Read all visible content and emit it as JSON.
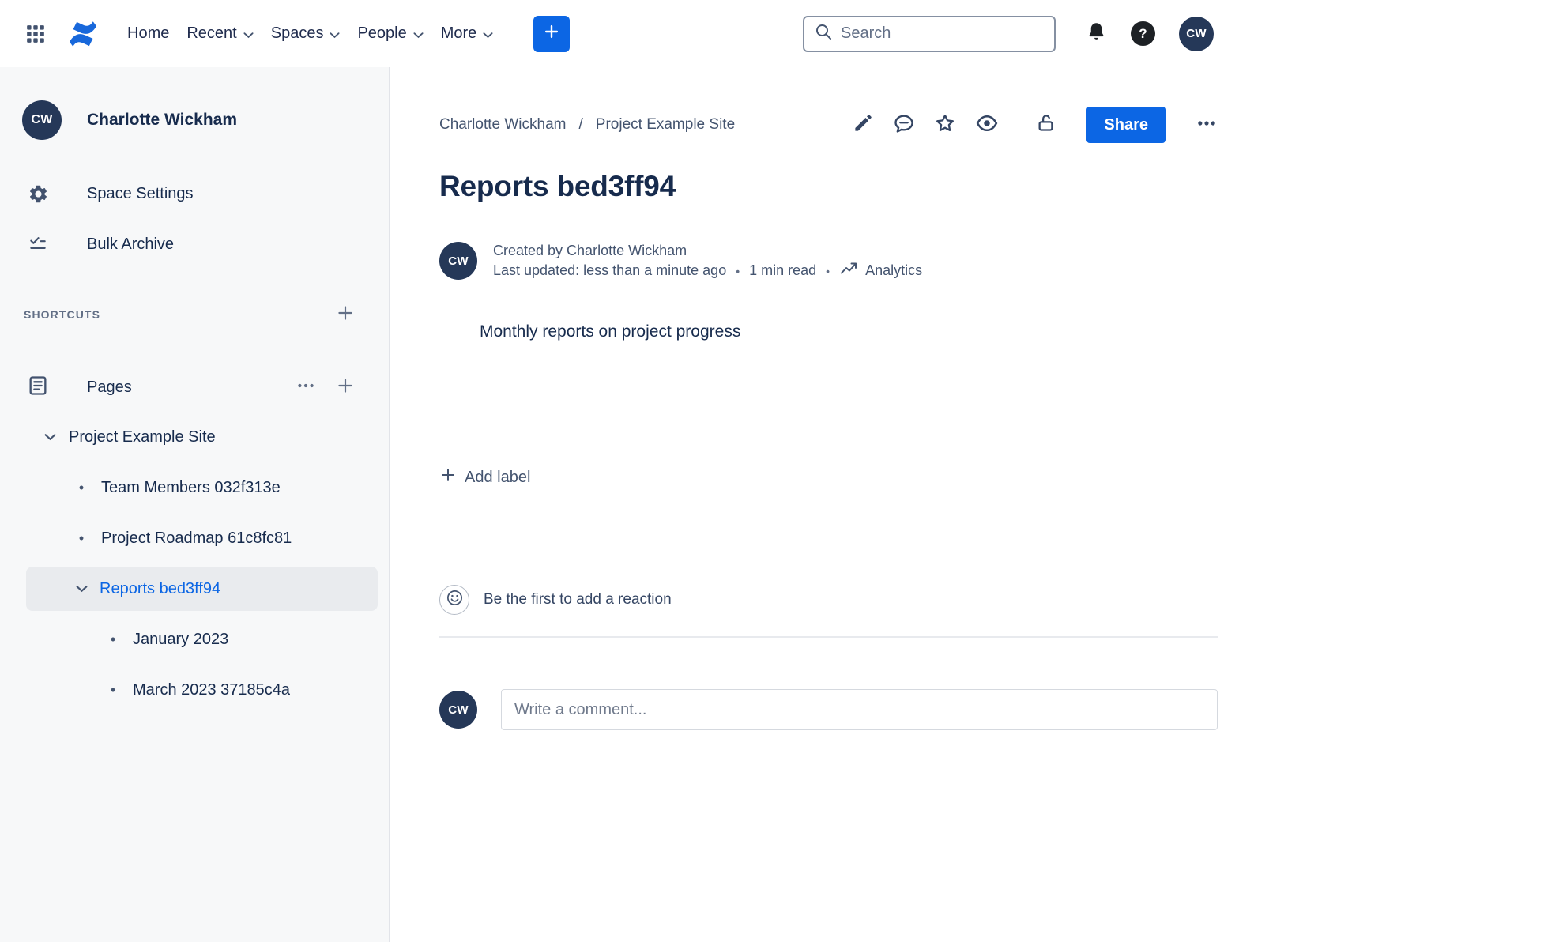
{
  "glyphs": {
    "bullet": "•",
    "question": "?"
  },
  "topbar": {
    "nav": [
      "Home",
      "Recent",
      "Spaces",
      "People",
      "More"
    ],
    "search_placeholder": "Search",
    "avatar_initials": "CW"
  },
  "sidebar": {
    "user_name": "Charlotte Wickham",
    "user_initials": "CW",
    "items": [
      "Space Settings",
      "Bulk Archive"
    ],
    "shortcuts_heading": "SHORTCUTS",
    "pages_heading": "Pages",
    "tree": {
      "root": "Project Example Site",
      "children": [
        "Team Members 032f313e",
        "Project Roadmap 61c8fc81"
      ],
      "selected": "Reports bed3ff94",
      "grandchildren": [
        "January 2023",
        "March 2023 37185c4a"
      ]
    }
  },
  "main": {
    "breadcrumb": [
      "Charlotte Wickham",
      "Project Example Site"
    ],
    "breadcrumb_separator": "/",
    "share_button": "Share",
    "title": "Reports bed3ff94",
    "byline": {
      "initials": "CW",
      "created_by": "Created by Charlotte Wickham",
      "last_updated": "Last updated: less than a minute ago",
      "separator": "•",
      "read_time": "1 min read",
      "analytics_label": "Analytics"
    },
    "body_text": "Monthly reports on project progress",
    "add_label_button": "Add label",
    "reaction_prompt": "Be the first to add a reaction",
    "comment": {
      "initials": "CW",
      "placeholder": "Write a comment..."
    }
  },
  "colors": {
    "accent_blue": "#0c66e4",
    "logo_blue": "#1868db",
    "heading_navy": "#172b4d",
    "avatar_navy": "#253858",
    "sidebar_bg": "#f7f8f9",
    "selected_bg": "#e9ebee",
    "muted_text": "#44546f"
  }
}
